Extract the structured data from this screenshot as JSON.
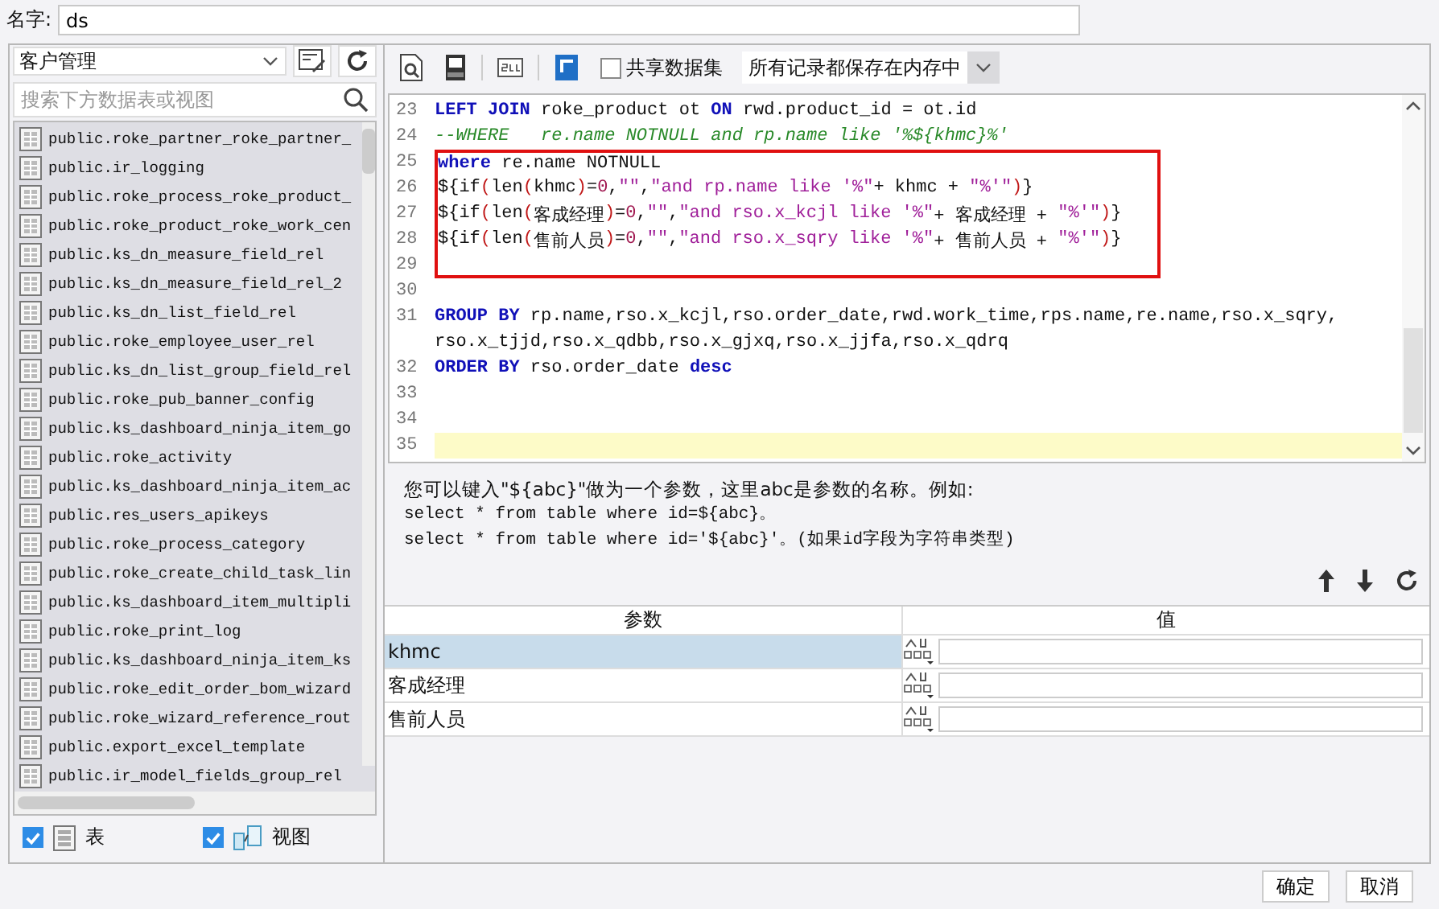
{
  "name_field": {
    "label": "名字:",
    "value": "ds"
  },
  "left_panel": {
    "dropdown": {
      "value": "客户管理"
    },
    "search": {
      "placeholder": "搜索下方数据表或视图"
    },
    "items": [
      "public.roke_partner_roke_partner_",
      "public.ir_logging",
      "public.roke_process_roke_product_",
      "public.roke_product_roke_work_cen",
      "public.ks_dn_measure_field_rel",
      "public.ks_dn_measure_field_rel_2",
      "public.ks_dn_list_field_rel",
      "public.roke_employee_user_rel",
      "public.ks_dn_list_group_field_rel",
      "public.roke_pub_banner_config",
      "public.ks_dashboard_ninja_item_go",
      "public.roke_activity",
      "public.ks_dashboard_ninja_item_ac",
      "public.res_users_apikeys",
      "public.roke_process_category",
      "public.roke_create_child_task_lin",
      "public.ks_dashboard_item_multipli",
      "public.roke_print_log",
      "public.ks_dashboard_ninja_item_ks",
      "public.roke_edit_order_bom_wizard",
      "public.roke_wizard_reference_rout",
      "public.export_excel_template",
      "public.ir_model_fields_group_rel"
    ],
    "filters": [
      {
        "kind": "table",
        "label": "表",
        "checked": true
      },
      {
        "kind": "view",
        "label": "视图",
        "checked": true
      }
    ]
  },
  "toolbar": {
    "share": {
      "label": "共享数据集",
      "checked": false
    },
    "storage": {
      "value": "所有记录都保存在内存中"
    }
  },
  "editor": {
    "lines": [
      {
        "number": "23",
        "boxed": false,
        "current": false,
        "tokens": [
          {
            "kind": "kw",
            "text": "LEFT JOIN"
          },
          {
            "kind": "plain",
            "text": " roke_product ot "
          },
          {
            "kind": "kw",
            "text": "ON"
          },
          {
            "kind": "plain",
            "text": " rwd.product_id = ot.id"
          }
        ]
      },
      {
        "number": "24",
        "boxed": false,
        "current": false,
        "tokens": [
          {
            "kind": "comment",
            "text": "--WHERE   re.name NOTNULL and rp.name like '%${khmc}%'"
          }
        ]
      },
      {
        "number": "25",
        "boxed": true,
        "current": false,
        "tokens": [
          {
            "kind": "kw",
            "text": "where"
          },
          {
            "kind": "plain",
            "text": " re.name NOTNULL"
          }
        ]
      },
      {
        "number": "26",
        "boxed": true,
        "current": false,
        "tokens": [
          {
            "kind": "plain",
            "text": "${if"
          },
          {
            "kind": "paren",
            "text": "("
          },
          {
            "kind": "plain",
            "text": "len"
          },
          {
            "kind": "paren",
            "text": "("
          },
          {
            "kind": "plain",
            "text": "khmc"
          },
          {
            "kind": "paren",
            "text": ")"
          },
          {
            "kind": "plain",
            "text": "="
          },
          {
            "kind": "num",
            "text": "0"
          },
          {
            "kind": "plain",
            "text": ","
          },
          {
            "kind": "str",
            "text": "\"\""
          },
          {
            "kind": "plain",
            "text": ","
          },
          {
            "kind": "str",
            "text": "\"and rp.name like '%\""
          },
          {
            "kind": "plain",
            "text": "+ khmc + "
          },
          {
            "kind": "str",
            "text": "\"%'\""
          },
          {
            "kind": "paren",
            "text": ")"
          },
          {
            "kind": "plain",
            "text": "}"
          }
        ]
      },
      {
        "number": "27",
        "boxed": true,
        "current": false,
        "tokens": [
          {
            "kind": "plain",
            "text": "${if"
          },
          {
            "kind": "paren",
            "text": "("
          },
          {
            "kind": "plain",
            "text": "len"
          },
          {
            "kind": "paren",
            "text": "("
          },
          {
            "kind": "plain",
            "text": "客成经理"
          },
          {
            "kind": "paren",
            "text": ")"
          },
          {
            "kind": "plain",
            "text": "="
          },
          {
            "kind": "num",
            "text": "0"
          },
          {
            "kind": "plain",
            "text": ","
          },
          {
            "kind": "str",
            "text": "\"\""
          },
          {
            "kind": "plain",
            "text": ","
          },
          {
            "kind": "str",
            "text": "\"and rso.x_kcjl like '%\""
          },
          {
            "kind": "plain",
            "text": "+ 客成经理 + "
          },
          {
            "kind": "str",
            "text": "\"%'\""
          },
          {
            "kind": "paren",
            "text": ")"
          },
          {
            "kind": "plain",
            "text": "}"
          }
        ]
      },
      {
        "number": "28",
        "boxed": true,
        "current": false,
        "tokens": [
          {
            "kind": "plain",
            "text": "${if"
          },
          {
            "kind": "paren",
            "text": "("
          },
          {
            "kind": "plain",
            "text": "len"
          },
          {
            "kind": "paren",
            "text": "("
          },
          {
            "kind": "plain",
            "text": "售前人员"
          },
          {
            "kind": "paren",
            "text": ")"
          },
          {
            "kind": "plain",
            "text": "="
          },
          {
            "kind": "num",
            "text": "0"
          },
          {
            "kind": "plain",
            "text": ","
          },
          {
            "kind": "str",
            "text": "\"\""
          },
          {
            "kind": "plain",
            "text": ","
          },
          {
            "kind": "str",
            "text": "\"and rso.x_sqry like '%\""
          },
          {
            "kind": "plain",
            "text": "+ 售前人员 + "
          },
          {
            "kind": "str",
            "text": "\"%'\""
          },
          {
            "kind": "paren",
            "text": ")"
          },
          {
            "kind": "plain",
            "text": "}"
          }
        ]
      },
      {
        "number": "29",
        "boxed": true,
        "current": false
      },
      {
        "number": "30",
        "boxed": false,
        "current": false
      },
      {
        "number": "31",
        "boxed": false,
        "current": false,
        "tokens": [
          {
            "kind": "kw",
            "text": "GROUP BY"
          },
          {
            "kind": "plain",
            "text": " rp.name,rso.x_kcjl,rso.order_date,rwd.work_time,rps.name,re.name,rso.x_sqry,"
          }
        ]
      },
      {
        "boxed": false,
        "current": false,
        "tokens": [
          {
            "kind": "plain",
            "text": "rso.x_tjjd,rso.x_qdbb,rso.x_gjxq,rso.x_jjfa,rso.x_qdrq"
          }
        ]
      },
      {
        "number": "32",
        "boxed": false,
        "current": false,
        "tokens": [
          {
            "kind": "kw",
            "text": "ORDER BY"
          },
          {
            "kind": "plain",
            "text": " rso.order_date "
          },
          {
            "kind": "kw",
            "text": "desc"
          }
        ]
      },
      {
        "number": "33",
        "boxed": false,
        "current": false
      },
      {
        "number": "34",
        "boxed": false,
        "current": false
      },
      {
        "number": "35",
        "boxed": false,
        "current": true
      }
    ]
  },
  "help": [
    "您可以键入\"${abc}\"做为一个参数，这里abc是参数的名称。例如:",
    "select * from table where id=${abc}。",
    "select * from table where id='${abc}'。(如果id字段为字符串类型)"
  ],
  "params": {
    "columns": [
      "参数",
      "值"
    ],
    "rows": [
      {
        "name": "khmc",
        "selected": true
      },
      {
        "name": "客成经理",
        "selected": false
      },
      {
        "name": "售前人员",
        "selected": false
      }
    ]
  },
  "buttons": [
    "确定",
    "取消"
  ]
}
